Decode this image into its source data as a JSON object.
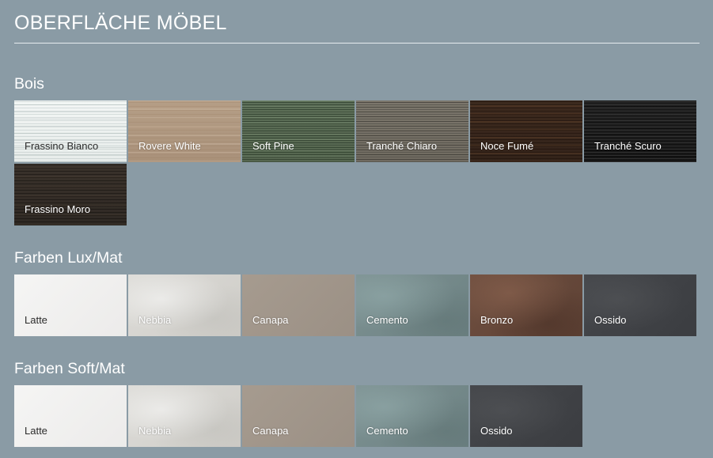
{
  "page_title": "OBERFLÄCHE MÖBEL",
  "sections": {
    "bois": {
      "title": "Bois",
      "items": [
        {
          "label": "Frassino Bianco",
          "color": "#eceff0"
        },
        {
          "label": "Rovere White",
          "color": "#b09880"
        },
        {
          "label": "Soft Pine",
          "color": "#5a6b55"
        },
        {
          "label": "Tranché Chiaro",
          "color": "#767166"
        },
        {
          "label": "Noce Fumé",
          "color": "#3a281d"
        },
        {
          "label": "Tranché Scuro",
          "color": "#1a1a1a"
        },
        {
          "label": "Frassino Moro",
          "color": "#352e28"
        }
      ]
    },
    "lux_mat": {
      "title": "Farben Lux/Mat",
      "items": [
        {
          "label": "Latte",
          "color": "#f2f2f1"
        },
        {
          "label": "Nebbia",
          "color": "#d6d5d1"
        },
        {
          "label": "Canapa",
          "color": "#a1968a"
        },
        {
          "label": "Cemento",
          "color": "#768a8b"
        },
        {
          "label": "Bronzo",
          "color": "#674839"
        },
        {
          "label": "Ossido",
          "color": "#404246"
        }
      ]
    },
    "soft_mat": {
      "title": "Farben Soft/Mat",
      "items": [
        {
          "label": "Latte",
          "color": "#f2f2f1"
        },
        {
          "label": "Nebbia",
          "color": "#d6d5d1"
        },
        {
          "label": "Canapa",
          "color": "#a1968a"
        },
        {
          "label": "Cemento",
          "color": "#768a8b"
        },
        {
          "label": "Ossido",
          "color": "#404246"
        }
      ]
    }
  },
  "colors": {
    "background": "#8a9ba5",
    "text": "#ffffff",
    "rule": "#e6ecef"
  }
}
